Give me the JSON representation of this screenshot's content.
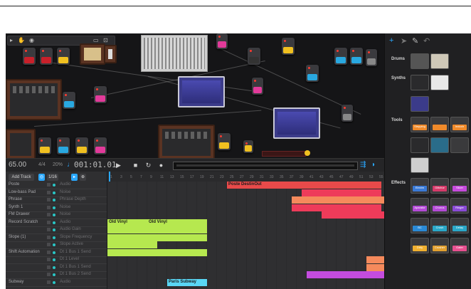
{
  "transport": {
    "tempo": "65.00",
    "meter": "4/4",
    "swing": "20%",
    "time": "001:01.01",
    "buttons": [
      "play",
      "stop",
      "loop",
      "record"
    ]
  },
  "sequencer": {
    "add_track": "Add Track",
    "grid": "1/16",
    "ruler": [
      "1",
      "3",
      "5",
      "7",
      "9",
      "11",
      "13",
      "15",
      "17",
      "19",
      "21",
      "23",
      "25",
      "27",
      "29",
      "31",
      "33",
      "35",
      "37",
      "39",
      "41",
      "43",
      "45",
      "47",
      "49",
      "51",
      "53",
      "55"
    ],
    "tracks": [
      {
        "name": "Poste",
        "device": "Audio",
        "dim": false
      },
      {
        "name": "Low-bass Pad",
        "device": "Noise",
        "dim": false
      },
      {
        "name": "Phrase",
        "device": "Phrase Depth",
        "dim": false
      },
      {
        "name": "Synth 1",
        "device": "Noise",
        "dim": false
      },
      {
        "name": "FM Drawer",
        "device": "Noise",
        "dim": false
      },
      {
        "name": "Record Scratch",
        "device": "Audio",
        "dim": false
      },
      {
        "name": "",
        "device": "Audio Gain",
        "dim": true
      },
      {
        "name": "Slope (1)",
        "device": "Slope Frequency",
        "dim": false
      },
      {
        "name": "",
        "device": "Slope Active",
        "dim": true
      },
      {
        "name": "Shift Automation",
        "device": "Dt 1 Bus 1 Send",
        "dim": false
      },
      {
        "name": "",
        "device": "Dt 1 Level",
        "dim": true
      },
      {
        "name": "",
        "device": "Dt 1 Bus 1 Send",
        "dim": true
      },
      {
        "name": "",
        "device": "Dt 1 Bus 2 Send",
        "dim": true
      },
      {
        "name": "Subway",
        "device": "Audio",
        "dim": false
      }
    ],
    "clips": [
      {
        "row": 0,
        "start": 25,
        "end": 56,
        "color": "#e84a4a",
        "label": "Poste DestinOut"
      },
      {
        "row": 1,
        "start": 40,
        "end": 56,
        "color": "#ee3b5a",
        "label": ""
      },
      {
        "row": 2,
        "start": 38,
        "end": 61,
        "color": "#f58a5c",
        "label": ""
      },
      {
        "row": 3,
        "start": 38,
        "end": 56,
        "color": "#ee3b5a",
        "label": ""
      },
      {
        "row": 4,
        "start": 44,
        "end": 58,
        "color": "#ee3b5a",
        "label": ""
      },
      {
        "row": 4,
        "start": 58,
        "end": 59,
        "color": "#b06a4a",
        "label": ""
      },
      {
        "row": 5,
        "start": 1,
        "end": 9,
        "color": "#b6e84f",
        "label": "Old Vinyl"
      },
      {
        "row": 5,
        "start": 9,
        "end": 21,
        "color": "#b6e84f",
        "label": "Old Vinyl"
      },
      {
        "row": 6,
        "start": 1,
        "end": 21,
        "color": "#b6e84f",
        "label": ""
      },
      {
        "row": 7,
        "start": 1,
        "end": 21,
        "color": "#b6e84f",
        "label": ""
      },
      {
        "row": 8,
        "start": 1,
        "end": 11,
        "color": "#b6e84f",
        "label": ""
      },
      {
        "row": 9,
        "start": 1,
        "end": 21,
        "color": "#b6e84f",
        "label": ""
      },
      {
        "row": 10,
        "start": 53,
        "end": 64,
        "color": "#f58a5c",
        "label": ""
      },
      {
        "row": 11,
        "start": 53,
        "end": 63,
        "color": "#f58a5c",
        "label": ""
      },
      {
        "row": 12,
        "start": 41,
        "end": 61,
        "color": "#c44cde",
        "label": ""
      },
      {
        "row": 13,
        "start": 13,
        "end": 21,
        "color": "#5ad7f5",
        "label": "Paris Subway"
      }
    ]
  },
  "library": {
    "categories": [
      "Drums",
      "Synths",
      "Tools",
      "Effects"
    ],
    "tools_items": [
      {
        "label": "Stepping"
      },
      {
        "label": "",
        "color": "#f08a2a"
      },
      {
        "label": "Inductr"
      }
    ],
    "effects_items": [
      {
        "label": "Electrn",
        "color": "#3a7ad6"
      },
      {
        "label": "Glitchor",
        "color": "#d63a6a"
      },
      {
        "label": "Slicer",
        "color": "#c64adc"
      },
      {
        "label": "Aparator",
        "color": "#b34ad6"
      },
      {
        "label": "Chorus",
        "color": "#b34ad6"
      },
      {
        "label": "Ringer",
        "color": "#8a4ad6"
      },
      {
        "label": "BC",
        "color": "#2a8ad6"
      },
      {
        "label": "Crush",
        "color": "#2aa8c8"
      },
      {
        "label": "Delay",
        "color": "#2aa8c8"
      },
      {
        "label": "Dirty",
        "color": "#f0b030"
      },
      {
        "label": "Crusher",
        "color": "#e2a030"
      },
      {
        "label": "Gater",
        "color": "#e85090"
      }
    ]
  },
  "colors": {
    "accent": "#2aa8ff",
    "teal": "#29c5c5"
  }
}
